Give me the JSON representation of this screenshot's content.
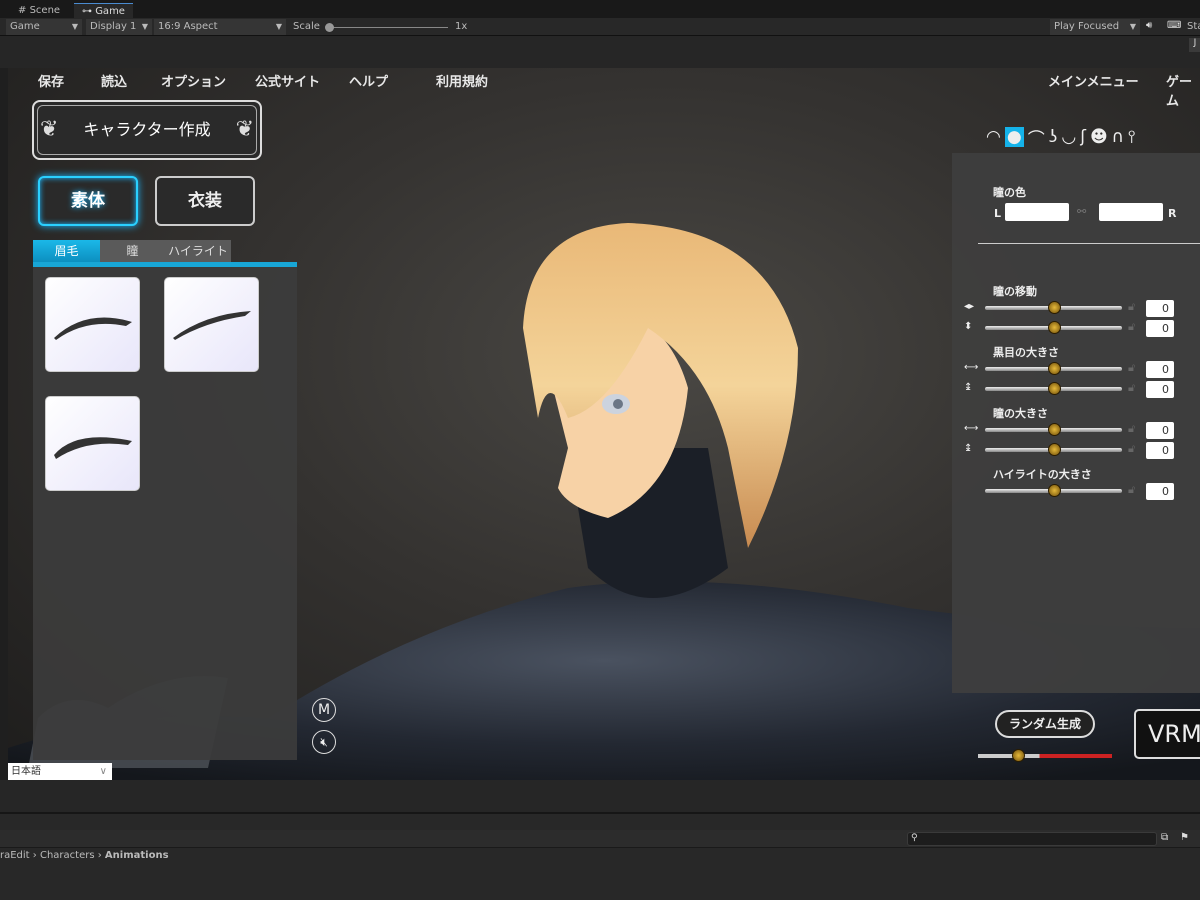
{
  "editor": {
    "tabs": [
      {
        "label": "Scene",
        "icon": "grid-icon"
      },
      {
        "label": "Game",
        "icon": "gamepad-icon"
      }
    ],
    "toolbar": {
      "game_dd": "Game",
      "display_dd": "Display 1",
      "aspect_dd": "16:9 Aspect",
      "scale_label": "Scale",
      "scale_value": "1x",
      "play_mode": "Play Focused",
      "stats_label": "Sta",
      "j_btn": "J"
    },
    "project": {
      "breadcrumb": [
        "raEdit",
        "Characters",
        "Animations"
      ]
    }
  },
  "game": {
    "menu": [
      "保存",
      "読込",
      "オプション",
      "公式サイト",
      "ヘルプ",
      "利用規約"
    ],
    "menu_right": [
      "メインメニュー",
      "ゲーム"
    ],
    "title": "キャラクター作成",
    "mode_buttons": [
      {
        "label": "素体",
        "selected": true
      },
      {
        "label": "衣装",
        "selected": false
      }
    ],
    "sub_tabs": [
      {
        "label": "眉毛",
        "selected": true
      },
      {
        "label": "瞳",
        "selected": false
      },
      {
        "label": "ハイライト",
        "selected": false
      }
    ],
    "accent": "#1ab8ff",
    "category_icons": [
      "eye-icon",
      "pupil-icon",
      "eyebrow-icon",
      "nose-icon",
      "lips-icon",
      "ear-icon",
      "face-icon",
      "hair-icon",
      "body-icon"
    ],
    "selected_category": "pupil-icon",
    "eye_color": {
      "label": "瞳の色",
      "left": "L",
      "right": "R"
    },
    "groups": [
      {
        "label": "瞳の移動",
        "sliders": [
          {
            "icon": "horizontal-arrows-icon",
            "value": "0",
            "level": 0.5
          },
          {
            "icon": "vertical-arrows-icon",
            "value": "0",
            "level": 0.5
          }
        ]
      },
      {
        "label": "黒目の大きさ",
        "sliders": [
          {
            "icon": "width-icon",
            "value": "0",
            "level": 0.5
          },
          {
            "icon": "height-icon",
            "value": "0",
            "level": 0.5
          }
        ]
      },
      {
        "label": "瞳の大きさ",
        "sliders": [
          {
            "icon": "width-icon",
            "value": "0",
            "level": 0.5
          },
          {
            "icon": "height-icon",
            "value": "0",
            "level": 0.5
          }
        ]
      },
      {
        "label": "ハイライトの大きさ",
        "sliders": [
          {
            "icon": "none",
            "value": "0",
            "level": 0.5
          }
        ]
      }
    ],
    "random_button": "ランダム生成",
    "random_level": 0.3,
    "vrm_button": "VRM",
    "language": "日本語",
    "m_button": "M"
  }
}
